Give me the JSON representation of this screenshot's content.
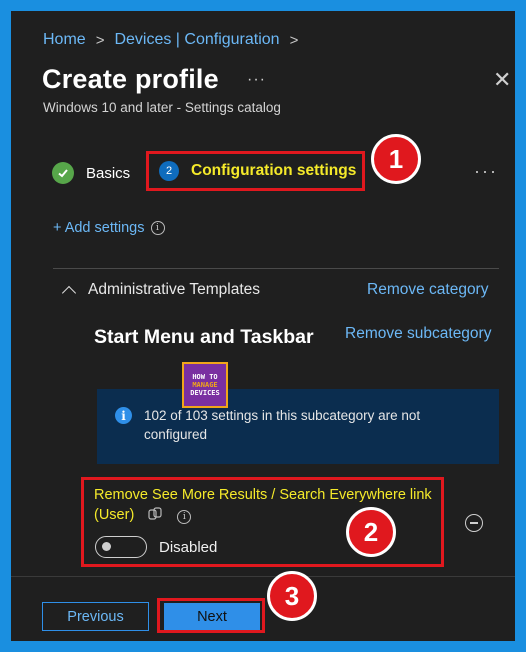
{
  "breadcrumb": {
    "home": "Home",
    "devices": "Devices | Configuration"
  },
  "header": {
    "title": "Create profile",
    "more": "···",
    "subtitle": "Windows 10 and later - Settings catalog",
    "close": "✕"
  },
  "steps": [
    {
      "label": "Basics",
      "state": "completed"
    },
    {
      "number": "2",
      "label": "Configuration settings",
      "state": "current"
    }
  ],
  "steps_more": "···",
  "add_settings": "+ Add settings",
  "category": {
    "name": "Administrative Templates",
    "remove_label": "Remove category",
    "subcategory": "Start Menu and Taskbar",
    "remove_sub_label": "Remove subcategory"
  },
  "logo": {
    "line1": "HOW TO",
    "line2": "MANAGE",
    "line3": "DEVICES"
  },
  "info": {
    "text": "102 of 103 settings in this subcategory are not configured"
  },
  "setting": {
    "label": "Remove See More Results / Search Everywhere link (User)",
    "toggle_label": "Disabled",
    "toggle_on": false
  },
  "annotations": {
    "one": "1",
    "two": "2",
    "three": "3"
  },
  "footer": {
    "previous": "Previous",
    "next": "Next"
  },
  "colors": {
    "frame": "#1a8fe0",
    "panel_bg": "#1f1f1f",
    "link": "#6cb8f6",
    "highlight_text": "#f5ea2a",
    "annotation_red": "#e0181e",
    "primary_button": "#2f8fe8"
  }
}
